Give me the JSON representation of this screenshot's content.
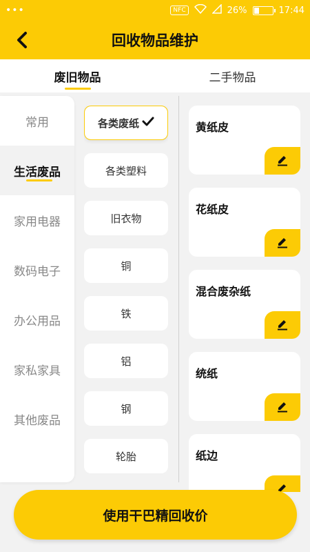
{
  "status_bar": {
    "dots": "•••",
    "nfc": "NFC",
    "battery": "26%",
    "battery_level": 0.26,
    "time": "17:44"
  },
  "app_bar": {
    "title": "回收物品维护",
    "back_icon": "back-arrow-icon"
  },
  "tabs": [
    {
      "label": "废旧物品",
      "active": true
    },
    {
      "label": "二手物品",
      "active": false
    }
  ],
  "sidebar": {
    "items": [
      {
        "label": "常用"
      },
      {
        "label": "生活废品",
        "active": true
      },
      {
        "label": "家用电器"
      },
      {
        "label": "数码电子"
      },
      {
        "label": "办公用品"
      },
      {
        "label": "家私家具"
      },
      {
        "label": "其他废品"
      }
    ]
  },
  "subcategories": [
    {
      "label": "各类废纸",
      "active": true
    },
    {
      "label": "各类塑料"
    },
    {
      "label": "旧衣物"
    },
    {
      "label": "铜"
    },
    {
      "label": "铁"
    },
    {
      "label": "铝"
    },
    {
      "label": "钢"
    },
    {
      "label": "轮胎"
    }
  ],
  "items": [
    {
      "name": "黄纸皮"
    },
    {
      "name": "花纸皮"
    },
    {
      "name": "混合废杂纸"
    },
    {
      "name": "统纸"
    },
    {
      "name": "纸边"
    }
  ],
  "bottom_button": {
    "label": "使用干巴精回收价"
  },
  "colors": {
    "accent": "#fccb05",
    "background": "#f2f2f2"
  }
}
